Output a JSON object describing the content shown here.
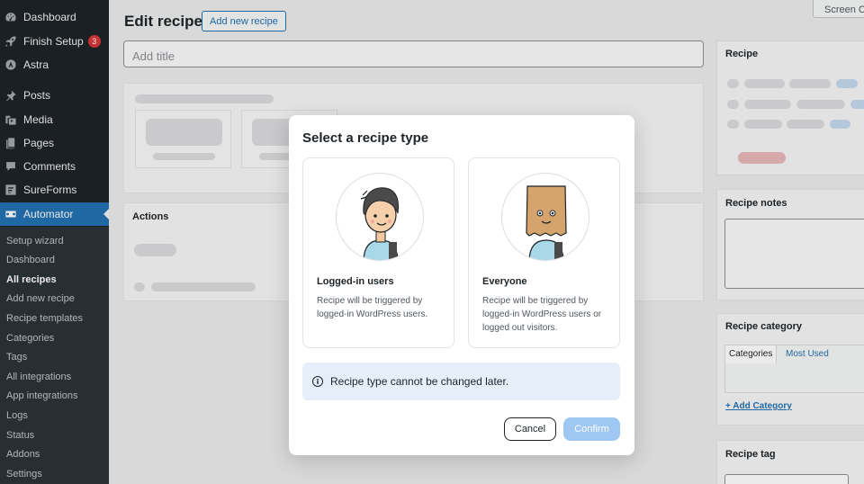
{
  "sidebar": {
    "menu": [
      {
        "label": "Dashboard",
        "icon": "dashboard-icon"
      },
      {
        "label": "Finish Setup",
        "icon": "rocket-icon",
        "badge": "3"
      },
      {
        "label": "Astra",
        "icon": "astra-icon"
      },
      {
        "label": "Posts",
        "icon": "pin-icon"
      },
      {
        "label": "Media",
        "icon": "media-icon"
      },
      {
        "label": "Pages",
        "icon": "pages-icon"
      },
      {
        "label": "Comments",
        "icon": "comment-icon"
      },
      {
        "label": "SureForms",
        "icon": "sureforms-icon"
      },
      {
        "label": "Automator",
        "icon": "automator-icon"
      }
    ],
    "submenu": [
      "Setup wizard",
      "Dashboard",
      "All recipes",
      "Add new recipe",
      "Recipe templates",
      "Categories",
      "Tags",
      "All integrations",
      "App integrations",
      "Logs",
      "Status",
      "Addons",
      "Settings"
    ]
  },
  "header": {
    "title": "Edit recipe",
    "add_new_label": "Add new recipe",
    "screen_options": "Screen Options"
  },
  "editor": {
    "title_placeholder": "Add title",
    "actions_title": "Actions"
  },
  "side_panels": {
    "recipe": "Recipe",
    "notes": "Recipe notes",
    "category": "Recipe category",
    "category_tab_all": "Categories",
    "category_tab_used": "Most Used",
    "add_category": "+ Add Category",
    "tag": "Recipe tag"
  },
  "modal": {
    "title": "Select a recipe type",
    "options": [
      {
        "title": "Logged-in users",
        "description": "Recipe will be triggered by logged-in WordPress users."
      },
      {
        "title": "Everyone",
        "description": "Recipe will be triggered by logged-in WordPress users or logged out visitors."
      }
    ],
    "notice": "Recipe type cannot be changed later.",
    "cancel_label": "Cancel",
    "confirm_label": "Confirm"
  },
  "colors": {
    "sidebar_bg": "#1d2327",
    "active_item": "#2271b1",
    "notice_bg": "#e6eefa",
    "confirm_bg": "#9ec7f2",
    "badge": "#d63638"
  }
}
